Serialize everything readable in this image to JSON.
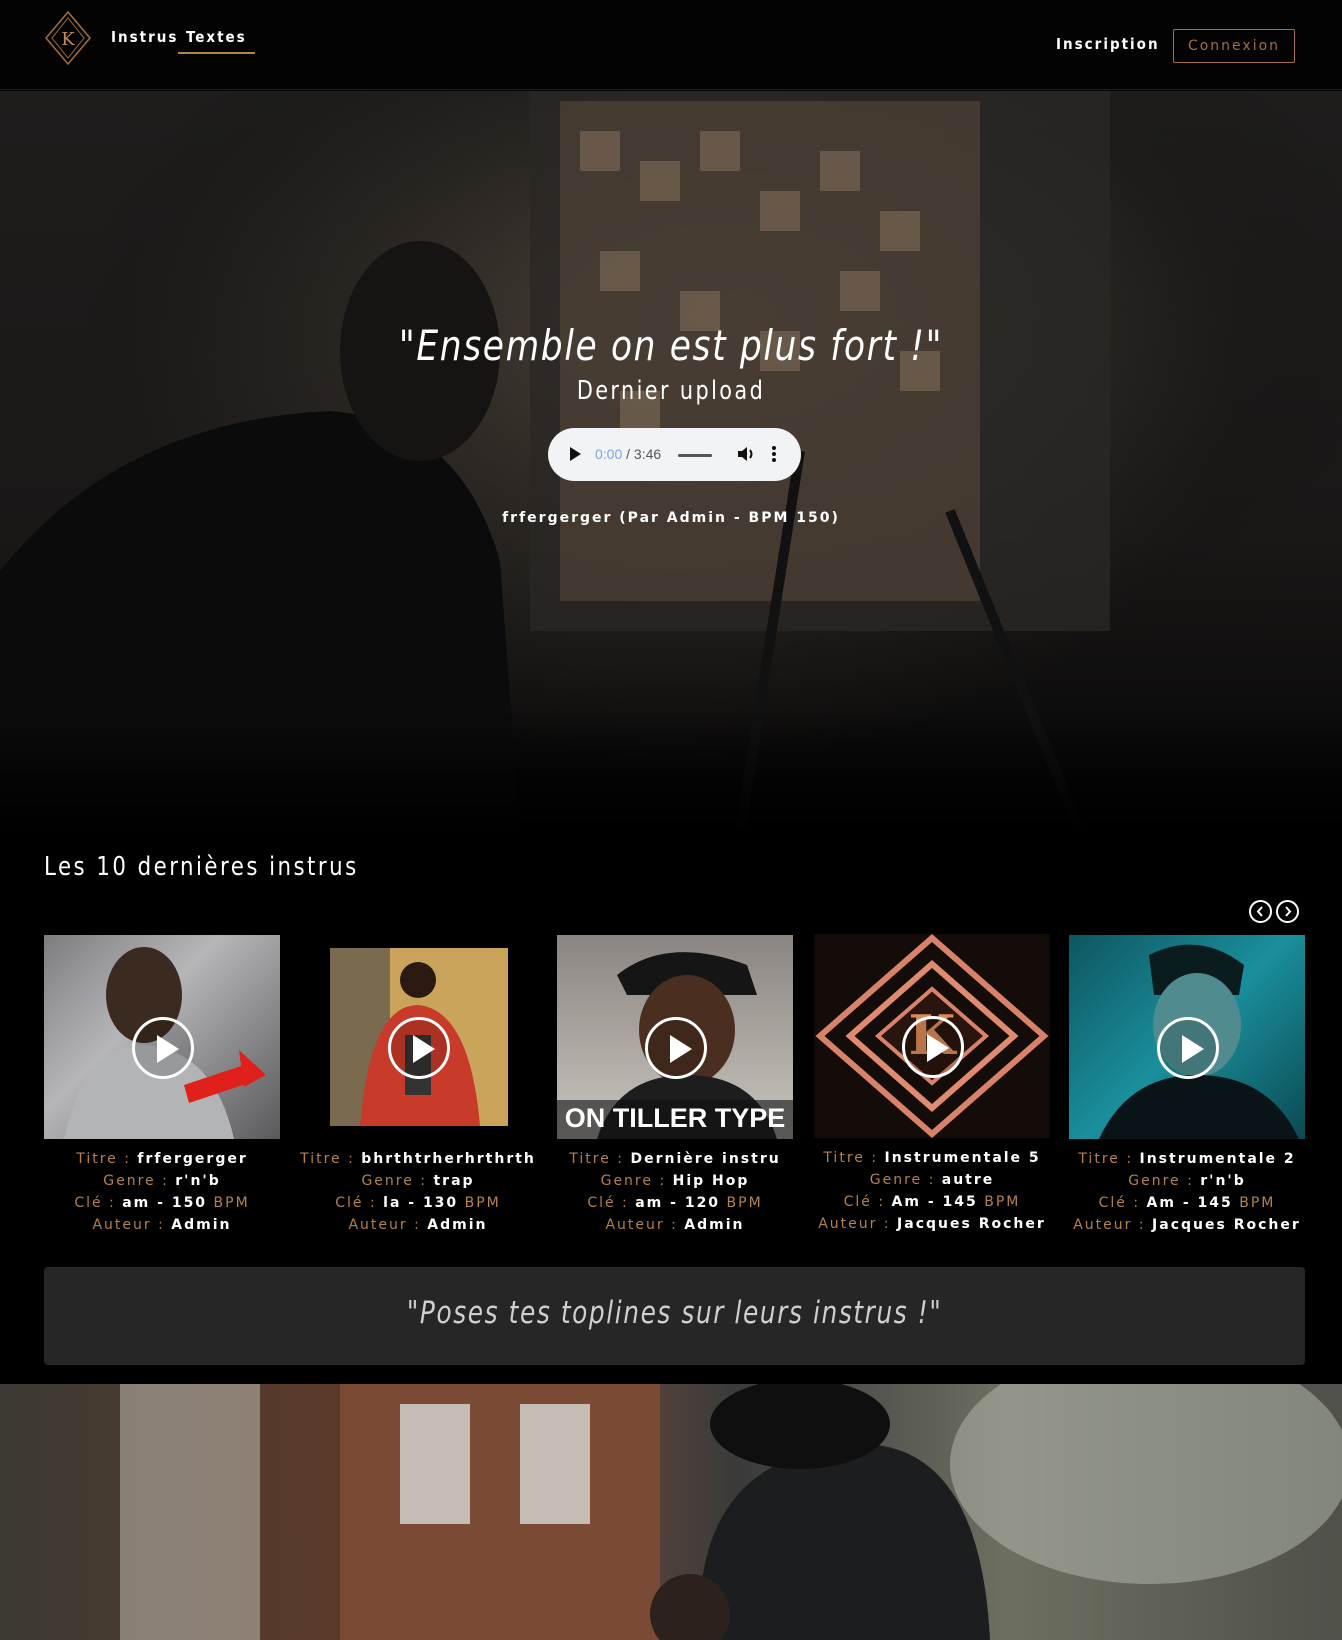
{
  "nav": {
    "links": [
      {
        "label": "Instrus"
      },
      {
        "label": "Textes"
      }
    ],
    "register_label": "Inscription",
    "login_label": "Connexion",
    "logo_letter": "K"
  },
  "hero": {
    "quote": "\"Ensemble on est plus fort !\"",
    "subtitle": "Dernier upload",
    "audio": {
      "current": "0:00",
      "duration": "/ 3:46"
    },
    "info": "frfergerger (Par Admin - BPM 150)"
  },
  "section": {
    "title": "Les 10 dernières instrus"
  },
  "labels": {
    "titre": "Titre : ",
    "genre": "Genre : ",
    "cle": "Clé : ",
    "bpm": "BPM",
    "auteur": "Auteur : "
  },
  "cards": [
    {
      "titre": "frfergerger",
      "genre": "r'n'b",
      "cle": "am - 150",
      "auteur": "Admin",
      "thumb": "man-with-headphones",
      "overlay": ""
    },
    {
      "titre": "bhrthtrherhrthrth",
      "genre": "trap",
      "cle": "la - 130",
      "auteur": "Admin",
      "thumb": "red-jacket",
      "overlay": ""
    },
    {
      "titre": "Dernière instru",
      "genre": "Hip Hop",
      "cle": "am - 120",
      "auteur": "Admin",
      "thumb": "cap-man",
      "overlay": "ON TILLER TYPE"
    },
    {
      "titre": "Instrumentale 5",
      "genre": "autre",
      "cle": "Am - 145",
      "auteur": "Jacques Rocher",
      "thumb": "k-logo",
      "overlay": ""
    },
    {
      "titre": "Instrumentale 2",
      "genre": "r'n'b",
      "cle": "Am - 145",
      "auteur": "Jacques Rocher",
      "thumb": "teal-portrait",
      "overlay": ""
    }
  ],
  "banner": {
    "text": "\"Poses tes toplines sur leurs instrus !\""
  },
  "colors": {
    "accent": "#b5814f",
    "button_border": "#a66d3d",
    "banner_bg": "#262626"
  }
}
